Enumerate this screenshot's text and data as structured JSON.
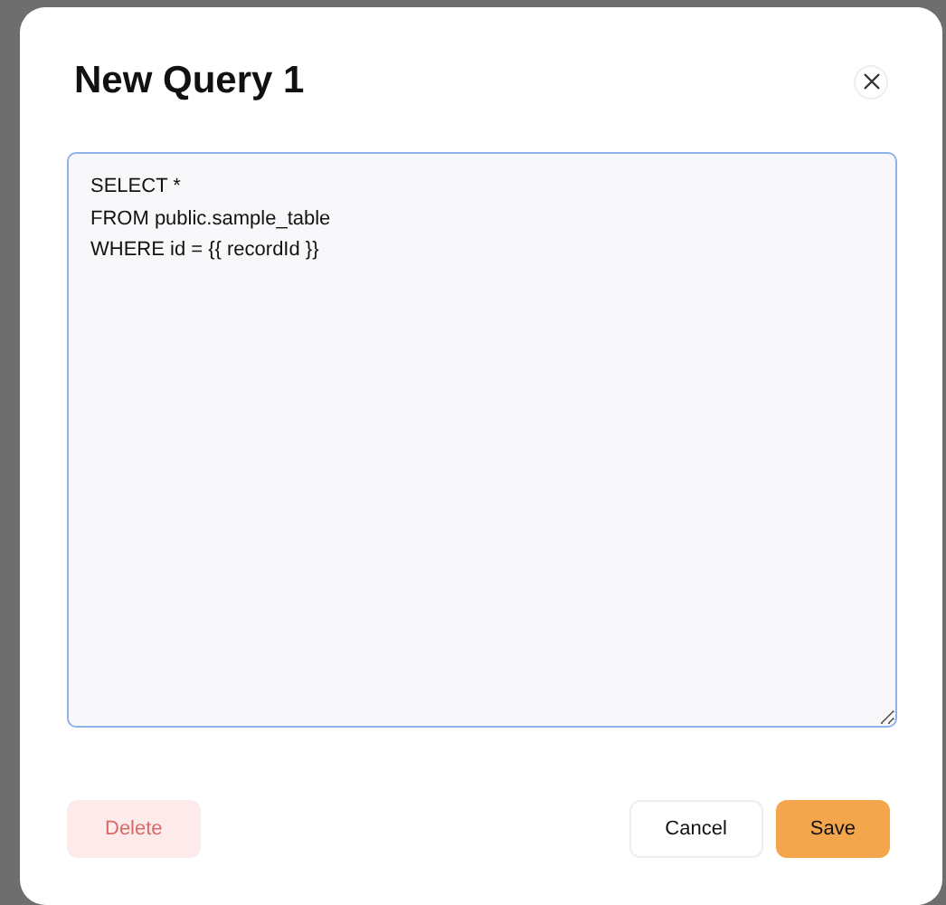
{
  "dialog": {
    "title": "New Query 1",
    "editor": {
      "value": "SELECT *\nFROM public.sample_table\nWHERE id = {{ recordId }}"
    },
    "buttons": [
      {
        "label": "Delete",
        "kind": "danger",
        "disabled": true
      },
      {
        "label": "Cancel",
        "kind": "secondary",
        "disabled": false
      },
      {
        "label": "Save",
        "kind": "primary",
        "disabled": false
      }
    ]
  }
}
